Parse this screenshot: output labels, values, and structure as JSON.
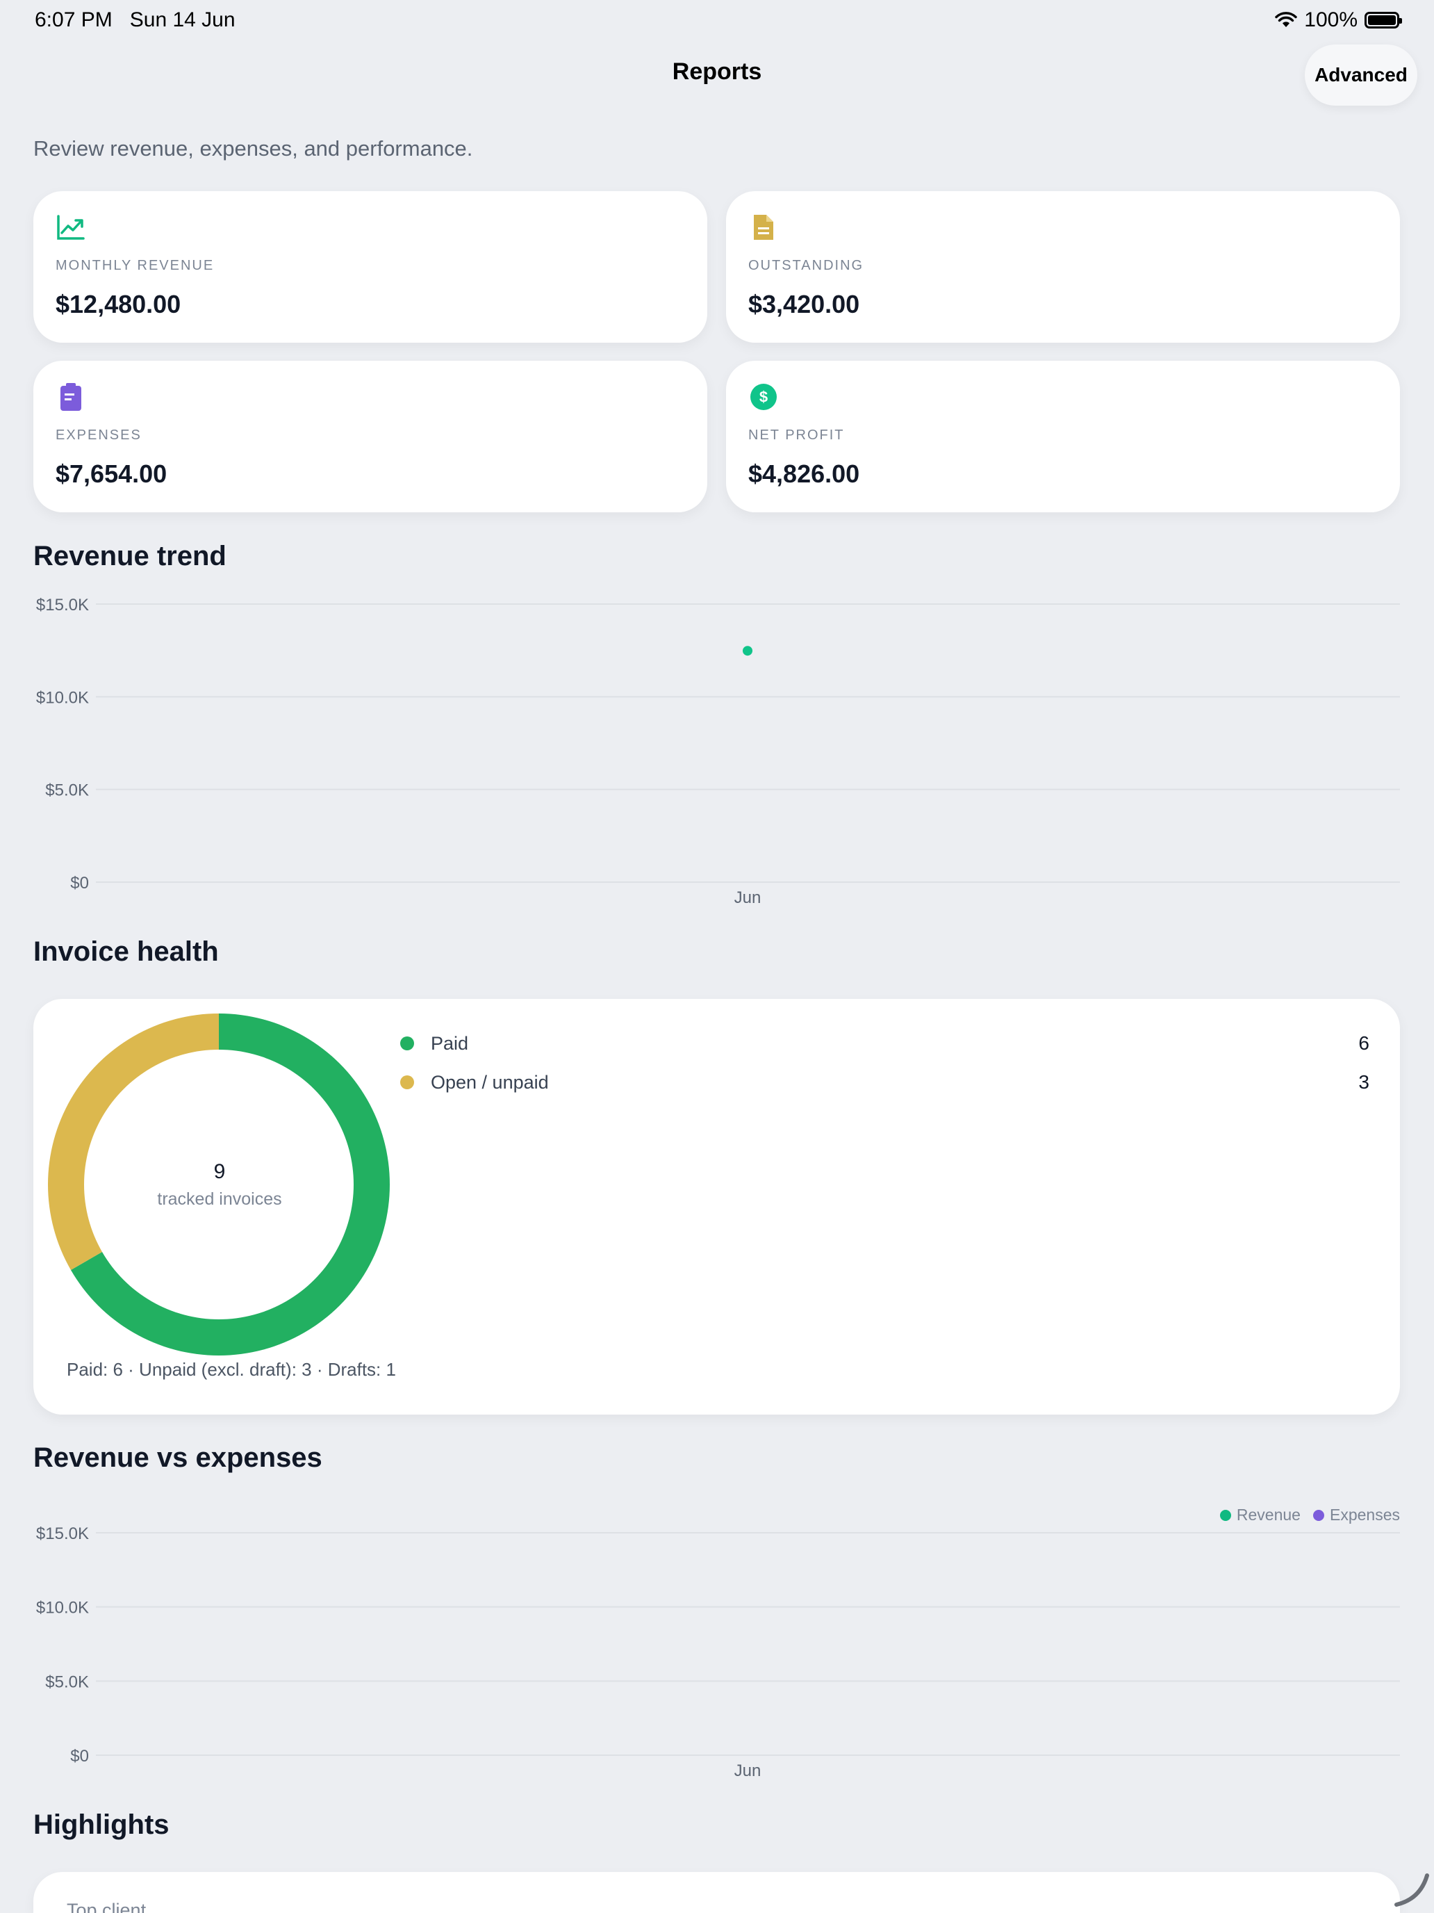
{
  "status_bar": {
    "time": "6:07 PM",
    "date": "Sun 14 Jun",
    "battery": "100%"
  },
  "header": {
    "title": "Reports",
    "advanced_button": "Advanced"
  },
  "subtitle": "Review revenue, expenses, and performance.",
  "stats": [
    {
      "label": "MONTHLY REVENUE",
      "value": "$12,480.00",
      "icon": "trend-up-icon",
      "color": "#10b981"
    },
    {
      "label": "OUTSTANDING",
      "value": "$3,420.00",
      "icon": "document-icon",
      "color": "#d4b14a"
    },
    {
      "label": "EXPENSES",
      "value": "$7,654.00",
      "icon": "clipboard-icon",
      "color": "#7c5cdb"
    },
    {
      "label": "NET PROFIT",
      "value": "$4,826.00",
      "icon": "dollar-circle-icon",
      "color": "#10c48a"
    }
  ],
  "revenue_trend": {
    "title": "Revenue trend",
    "chart_data": {
      "type": "scatter",
      "x": [
        "Jun"
      ],
      "y": [
        12480
      ],
      "ylim": [
        0,
        15000
      ],
      "yticks": [
        "$15.0K",
        "$10.0K",
        "$5.0K",
        "$0"
      ],
      "ytick_values": [
        15000,
        10000,
        5000,
        0
      ],
      "color": "#10c48a",
      "grid": true
    }
  },
  "invoice_health": {
    "title": "Invoice health",
    "total": "9",
    "total_label": "tracked invoices",
    "legend": [
      {
        "label": "Paid",
        "count": "6",
        "color": "#22b061"
      },
      {
        "label": "Open / unpaid",
        "count": "3",
        "color": "#dcb84e"
      }
    ],
    "footnote": "Paid: 6 · Unpaid (excl. draft): 3 · Drafts: 1",
    "chart_data": {
      "type": "pie",
      "labels": [
        "Paid",
        "Open / unpaid"
      ],
      "values": [
        6,
        3
      ],
      "colors": [
        "#22b061",
        "#dcb84e"
      ]
    }
  },
  "revenue_vs_expenses": {
    "title": "Revenue vs expenses",
    "legend": [
      {
        "label": "Revenue",
        "color": "#10b981"
      },
      {
        "label": "Expenses",
        "color": "#7c5cdb"
      }
    ],
    "chart_data": {
      "type": "bar",
      "categories": [
        "Jun"
      ],
      "series": [
        {
          "name": "Revenue",
          "values": []
        },
        {
          "name": "Expenses",
          "values": []
        }
      ],
      "ylim": [
        0,
        15000
      ],
      "yticks": [
        "$15.0K",
        "$10.0K",
        "$5.0K",
        "$0"
      ],
      "ytick_values": [
        15000,
        10000,
        5000,
        0
      ],
      "grid": true,
      "legend_position": "top-right"
    }
  },
  "highlights": {
    "title": "Highlights",
    "first_item_label": "Top client"
  }
}
